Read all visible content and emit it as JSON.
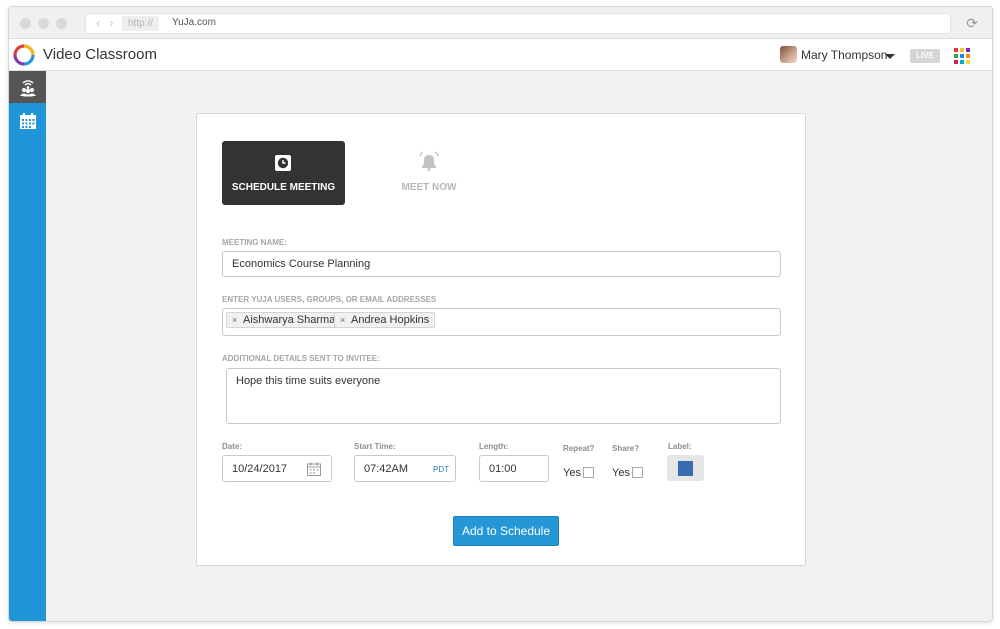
{
  "browser": {
    "url_protocol": "http://",
    "url_domain": "YuJa.com"
  },
  "header": {
    "app_title": "Video Classroom",
    "user_name": "Mary Thompson",
    "live_badge": "LIVE"
  },
  "tabs": {
    "schedule_label": "SCHEDULE MEETING",
    "meet_now_label": "MEET NOW"
  },
  "form": {
    "meeting_name_label": "MEETING NAME:",
    "meeting_name_value": "Economics Course Planning",
    "invitees_label": "ENTER YUJA USERS, GROUPS, OR EMAIL ADDRESSES",
    "invitees": [
      "Aishwarya Sharma",
      "Andrea Hopkins"
    ],
    "details_label": "ADDITIONAL DETAILS SENT TO INVITEE:",
    "details_value": "Hope this time suits everyone",
    "date_label": "Date:",
    "date_value": "10/24/2017",
    "start_time_label": "Start Time:",
    "start_time_value": "07:42AM",
    "timezone": "PDT",
    "length_label": "Length:",
    "length_value": "01:00",
    "repeat_label": "Repeat?",
    "repeat_option": "Yes",
    "share_label": "Share?",
    "share_option": "Yes",
    "label_label": "Label:",
    "label_color": "#3a6bb0",
    "submit_label": "Add to Schedule"
  },
  "colors": {
    "sidebar": "#2095d8",
    "primary_button": "#2597d6",
    "active_tab": "#333333"
  },
  "icons": {
    "sidebar_active": "live-meeting-icon",
    "sidebar_second": "calendar-icon",
    "schedule_tab": "clock-icon",
    "meet_now_tab": "bell-icon",
    "app_launcher": "apps-grid-icon"
  }
}
